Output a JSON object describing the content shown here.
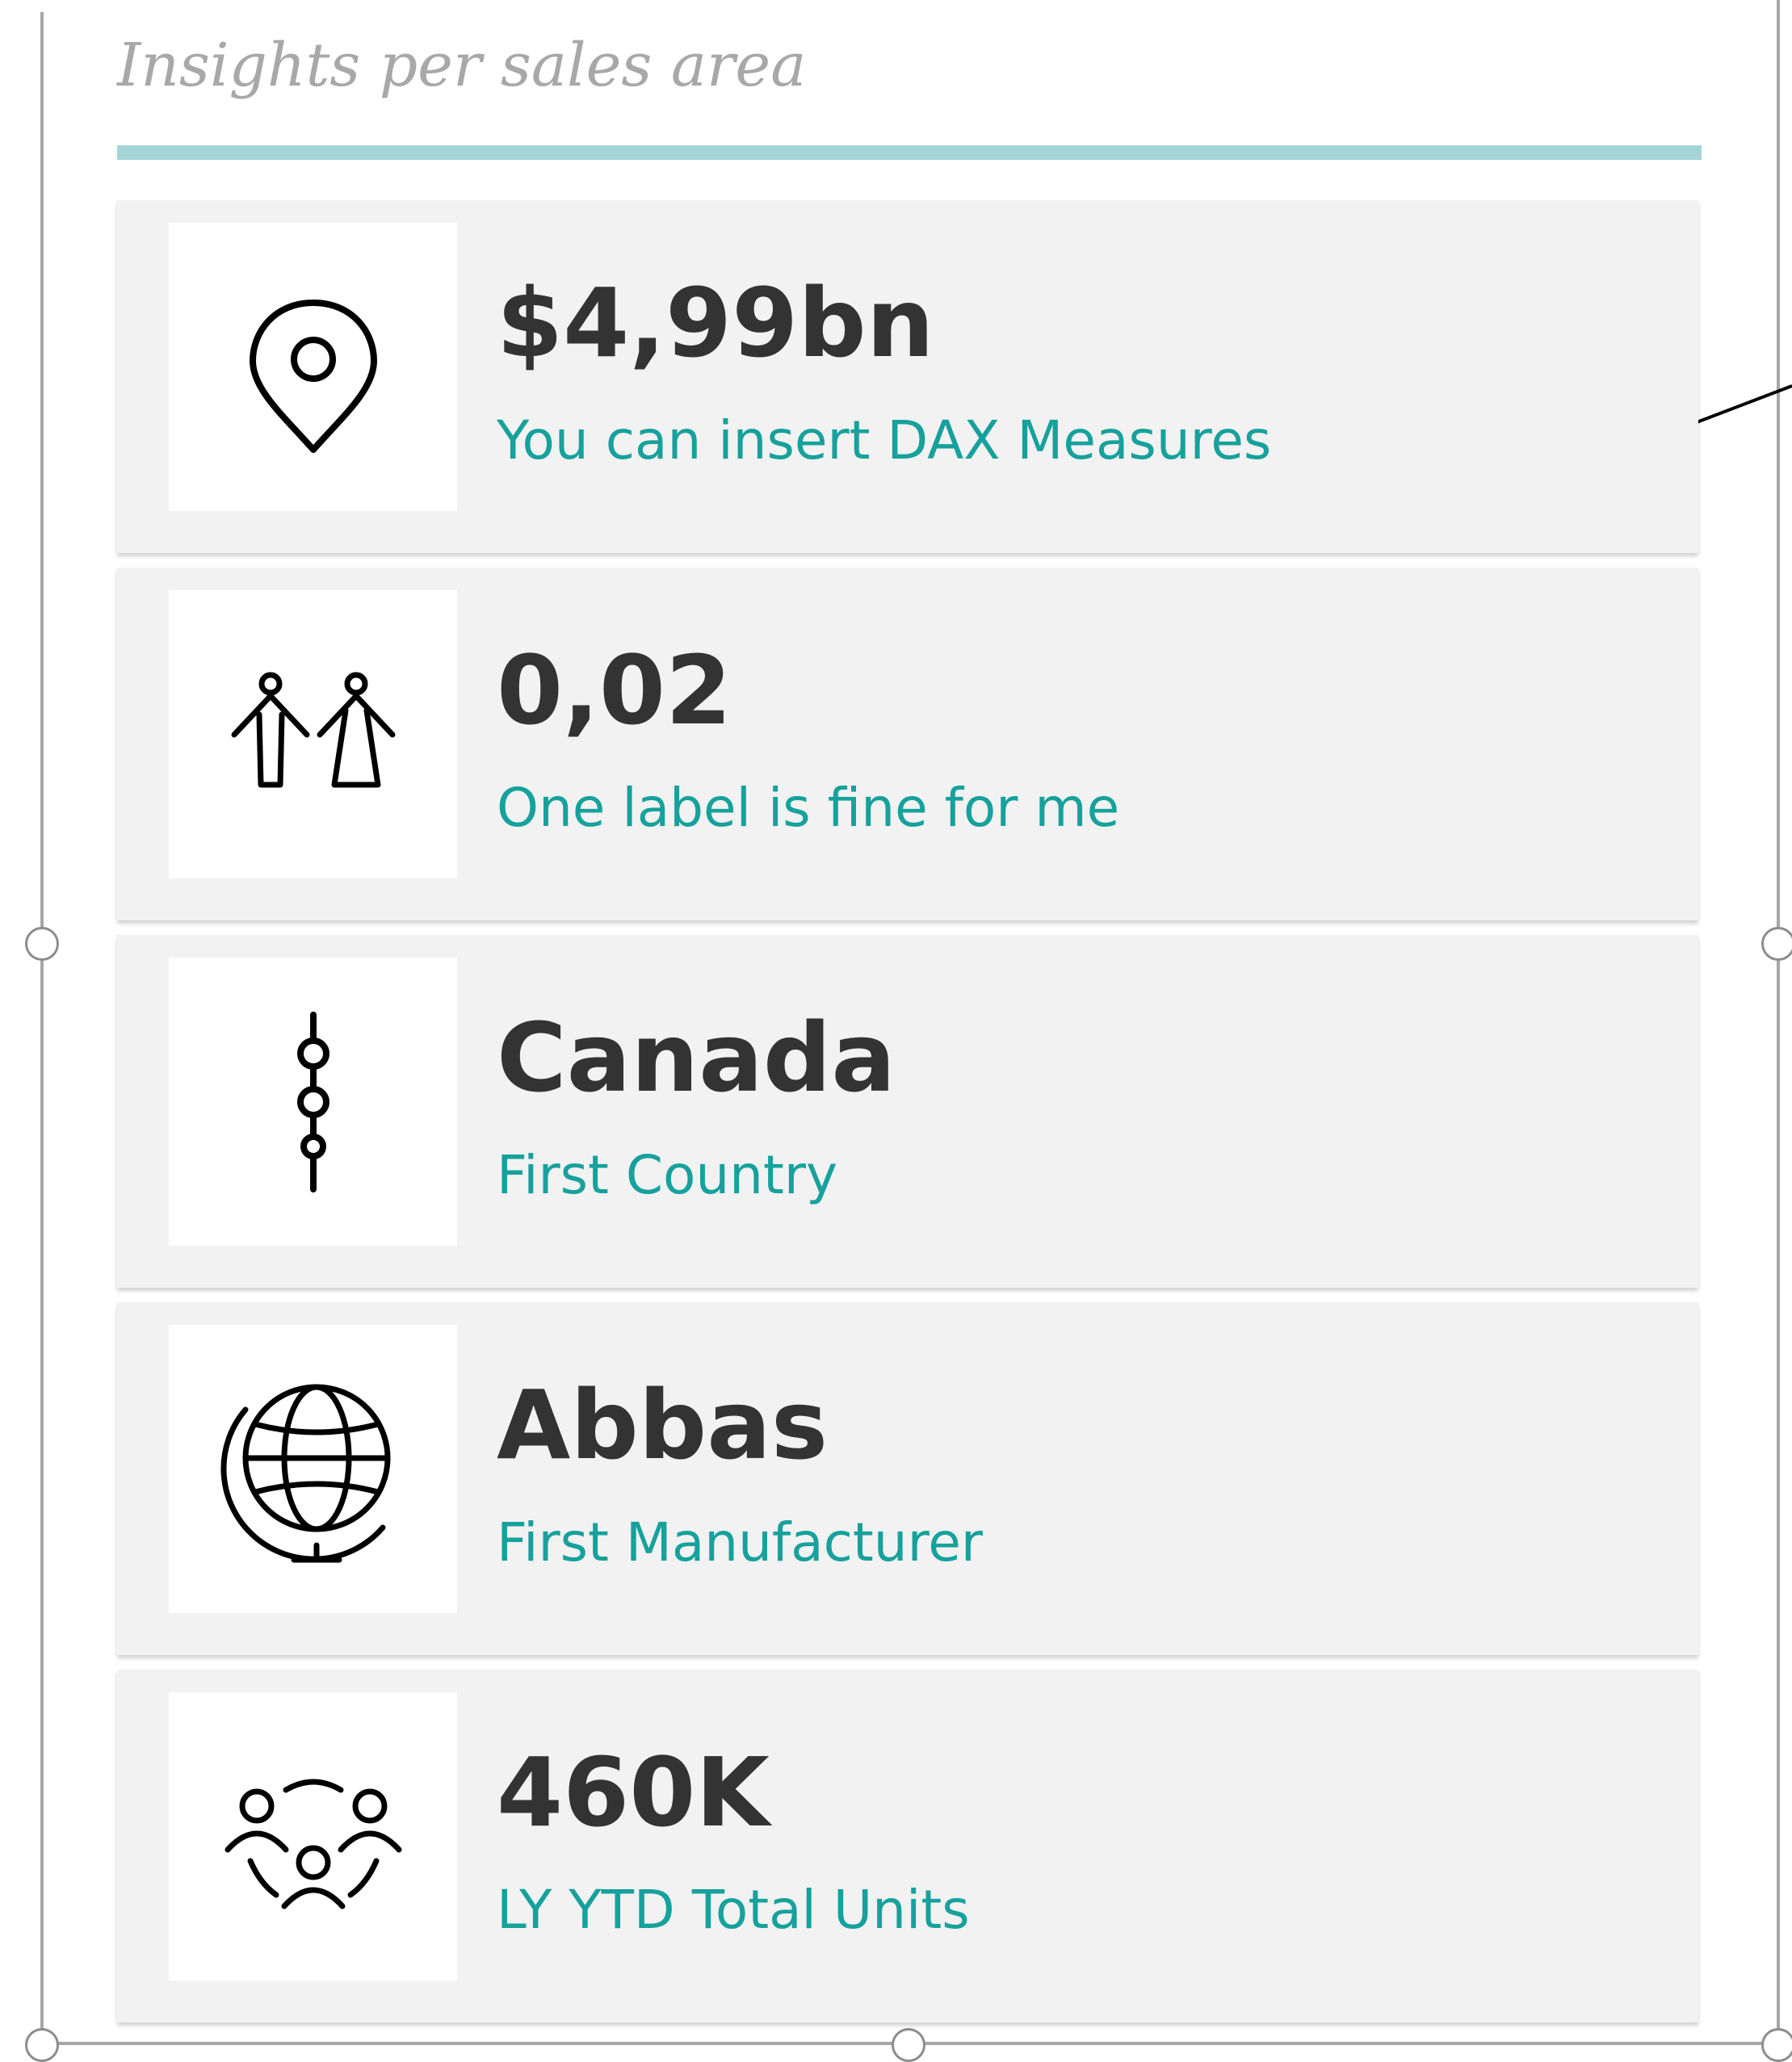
{
  "panel": {
    "title": "Insights per sales area",
    "accent_color": "#a3d5d7",
    "value_color": "#333333",
    "label_color": "#16a19c"
  },
  "cards": [
    {
      "icon": "map-pin-icon",
      "value": "$4,99bn",
      "label": "You can insert DAX Measures"
    },
    {
      "icon": "couple-icon",
      "value": "0,02",
      "label": "One label is fine for me"
    },
    {
      "icon": "node-chain-icon",
      "value": "Canada",
      "label": "First Country"
    },
    {
      "icon": "globe-icon",
      "value": "Abbas",
      "label": "First Manufacturer"
    },
    {
      "icon": "group-icon",
      "value": "460K",
      "label": "LY YTD Total Units"
    }
  ]
}
